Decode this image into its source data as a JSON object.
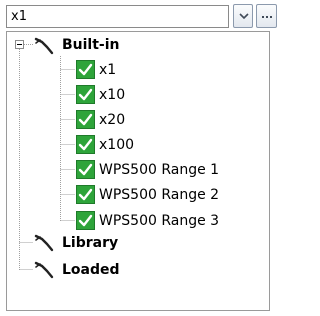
{
  "combo": {
    "value": "x1",
    "dropdown_icon": "chevron-down-icon",
    "more_icon": "ellipsis-icon"
  },
  "tree": {
    "root_nodes": [
      {
        "label": "Built-in",
        "icon": "curve-icon",
        "expanded": true,
        "children": [
          {
            "label": "x1",
            "checked": true,
            "selected": true
          },
          {
            "label": "x10",
            "checked": true
          },
          {
            "label": "x20",
            "checked": true
          },
          {
            "label": "x100",
            "checked": true
          },
          {
            "label": "WPS500 Range 1",
            "checked": true
          },
          {
            "label": "WPS500 Range 2",
            "checked": true
          },
          {
            "label": "WPS500 Range 3",
            "checked": true
          }
        ]
      },
      {
        "label": "Library",
        "icon": "curve-icon",
        "expanded": false
      },
      {
        "label": "Loaded",
        "icon": "curve-icon",
        "expanded": false
      }
    ]
  },
  "colors": {
    "check_green": "#2ea43a",
    "tree_line": "#a0a0a0",
    "button_border": "#8c9aad"
  }
}
